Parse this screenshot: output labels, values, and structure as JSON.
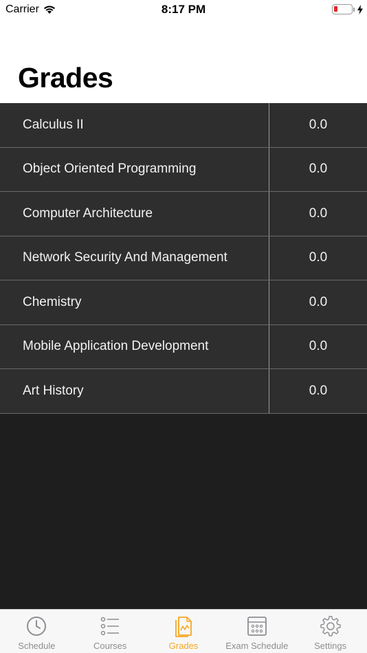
{
  "status": {
    "carrier": "Carrier",
    "time": "8:17 PM"
  },
  "page": {
    "title": "Grades"
  },
  "grades": [
    {
      "course": "Calculus II",
      "grade": "0.0"
    },
    {
      "course": "Object Oriented Programming",
      "grade": "0.0"
    },
    {
      "course": "Computer Architecture",
      "grade": "0.0"
    },
    {
      "course": "Network Security And Management",
      "grade": "0.0"
    },
    {
      "course": "Chemistry",
      "grade": "0.0"
    },
    {
      "course": "Mobile Application Development",
      "grade": "0.0"
    },
    {
      "course": "Art History",
      "grade": "0.0"
    }
  ],
  "tabs": [
    {
      "label": "Schedule",
      "icon": "clock-icon"
    },
    {
      "label": "Courses",
      "icon": "list-icon"
    },
    {
      "label": "Grades",
      "icon": "grades-document-icon"
    },
    {
      "label": "Exam Schedule",
      "icon": "calendar-icon"
    },
    {
      "label": "Settings",
      "icon": "gear-icon"
    }
  ],
  "colors": {
    "accent": "#f5a623",
    "inactive": "#8e8e93",
    "row_bg": "#2e2e2e",
    "background": "#1e1e1e"
  }
}
